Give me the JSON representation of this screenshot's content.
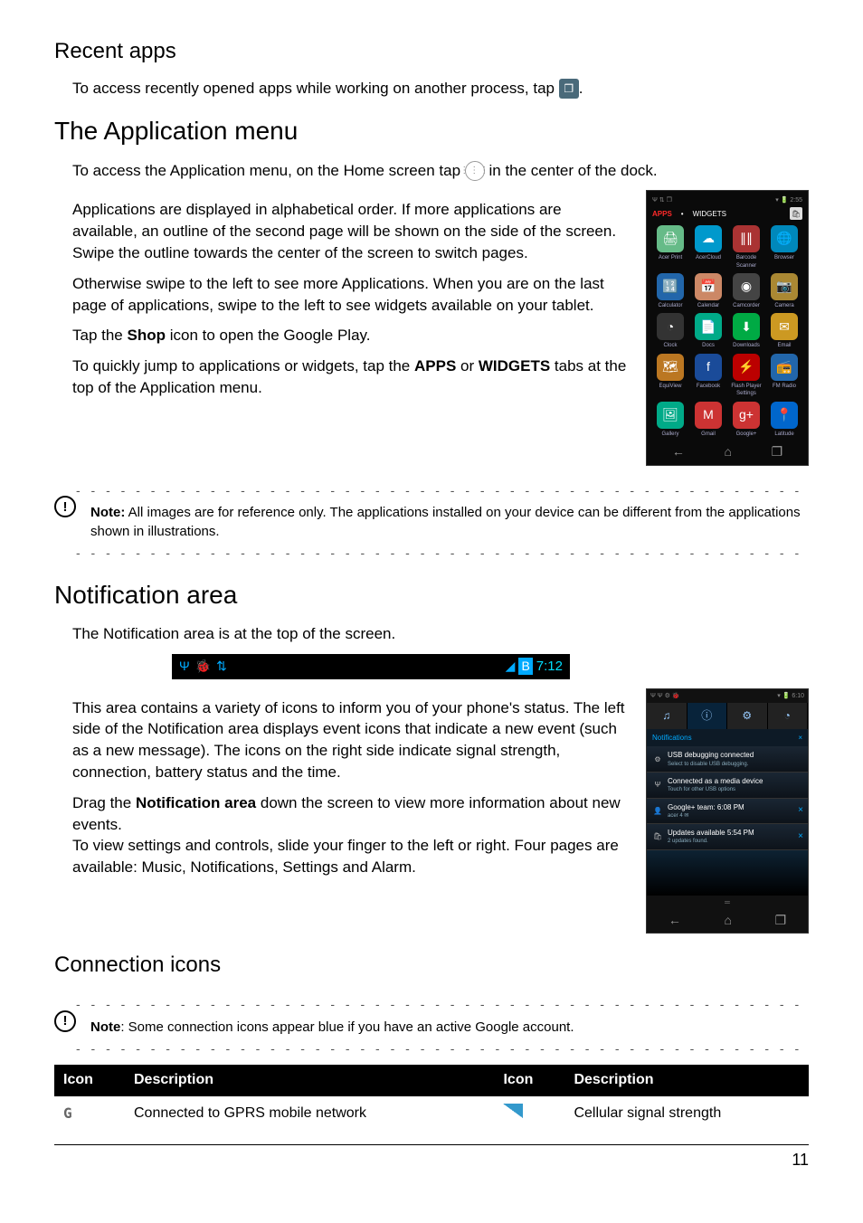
{
  "sections": {
    "recent_apps": {
      "title": "Recent apps",
      "body": "To access recently opened apps while working on another process, tap ",
      "body_end": "."
    },
    "app_menu": {
      "title": "The Application menu",
      "intro_a": "To access the Application menu, on the Home screen tap ",
      "intro_b": " in the center of the dock.",
      "p2": "Applications are displayed in alphabetical order. If more applications are available, an outline of the second page will be shown on the side of the screen. Swipe the outline towards the center of the screen to switch pages.",
      "p3": "Otherwise swipe to the left to see more Applications. When you are on the last page of applications, swipe to the left to see widgets available on your tablet.",
      "p4_a": "Tap the ",
      "p4_b": "Shop",
      "p4_c": " icon to open the Google Play.",
      "p5_a": "To quickly jump to applications or widgets, tap the ",
      "p5_b": "APPS",
      "p5_c": " or ",
      "p5_d": "WIDGETS",
      "p5_e": " tabs at the top of the Application menu."
    },
    "note1_a": "Note:",
    "note1_b": " All images are for reference only. The applications installed on your device can be different from the applications shown in illustrations.",
    "notif_area": {
      "title": "Notification area",
      "p1": "The Notification area is at the top of the screen.",
      "p2": "This area contains a variety of icons to inform you of your phone's status. The left side of the Notification area displays event icons that indicate a new event (such as a new message). The icons on the right side indicate signal strength, connection, battery status and the time.",
      "p3_a": "Drag the ",
      "p3_b": "Notification area",
      "p3_c": " down the screen to view more information about new events.",
      "p4": "To view settings and controls, slide your finger to the left or right. Four pages are available: Music, Notifications, Settings and Alarm."
    },
    "conn": {
      "title": "Connection icons",
      "note_a": "Note",
      "note_b": ": Some connection icons appear blue if you have an active Google account."
    }
  },
  "app_menu_shot": {
    "status_time": "2:55",
    "tab_apps": "APPS",
    "tab_widgets": "WIDGETS",
    "apps": [
      {
        "label": "Acer Print",
        "color": "#6b8",
        "glyph": "🖨"
      },
      {
        "label": "AcerCloud",
        "color": "#09c",
        "glyph": "☁"
      },
      {
        "label": "Barcode Scanner",
        "color": "#a33",
        "glyph": "∥∥"
      },
      {
        "label": "Browser",
        "color": "#08b",
        "glyph": "🌐"
      },
      {
        "label": "Calculator",
        "color": "#26a",
        "glyph": "🔢"
      },
      {
        "label": "Calendar",
        "color": "#c86",
        "glyph": "📅"
      },
      {
        "label": "Camcorder",
        "color": "#444",
        "glyph": "◉"
      },
      {
        "label": "Camera",
        "color": "#a83",
        "glyph": "📷"
      },
      {
        "label": "Clock",
        "color": "#333",
        "glyph": "◔"
      },
      {
        "label": "Docs",
        "color": "#0a8",
        "glyph": "📄"
      },
      {
        "label": "Downloads",
        "color": "#0a4",
        "glyph": "⬇"
      },
      {
        "label": "Email",
        "color": "#c92",
        "glyph": "✉"
      },
      {
        "label": "EquiView",
        "color": "#b72",
        "glyph": "🗺"
      },
      {
        "label": "Facebook",
        "color": "#1a4b99",
        "glyph": "f"
      },
      {
        "label": "Flash Player Settings",
        "color": "#b00",
        "glyph": "⚡"
      },
      {
        "label": "FM Radio",
        "color": "#26a",
        "glyph": "📻"
      },
      {
        "label": "Gallery",
        "color": "#0a8",
        "glyph": "🖼"
      },
      {
        "label": "Gmail",
        "color": "#c33",
        "glyph": "M"
      },
      {
        "label": "Google+",
        "color": "#c33",
        "glyph": "g+"
      },
      {
        "label": "Latitude",
        "color": "#06c",
        "glyph": "📍"
      }
    ]
  },
  "status_bar": {
    "time": "7:12"
  },
  "notif_shot": {
    "top_time": "6:10",
    "header": "Notifications",
    "items": [
      {
        "title": "USB debugging connected",
        "sub": "Select to disable USB debugging.",
        "icon": "⚙",
        "close": ""
      },
      {
        "title": "Connected as a media device",
        "sub": "Touch for other USB options",
        "icon": "Ψ",
        "close": ""
      },
      {
        "title": "Google+ team:",
        "sub": "acer",
        "time": "6:08 PM",
        "icon": "👤",
        "close": "×",
        "extra": "4 ✉"
      },
      {
        "title": "Updates available",
        "sub": "2 updates found.",
        "time": "5:54 PM",
        "icon": "🛍",
        "close": "×"
      }
    ]
  },
  "conn_table": {
    "h1": "Icon",
    "h2": "Description",
    "h3": "Icon",
    "h4": "Description",
    "r1c1": "G",
    "r1c2": "Connected to GPRS mobile network",
    "r1c4": "Cellular signal strength"
  },
  "page_number": "11"
}
